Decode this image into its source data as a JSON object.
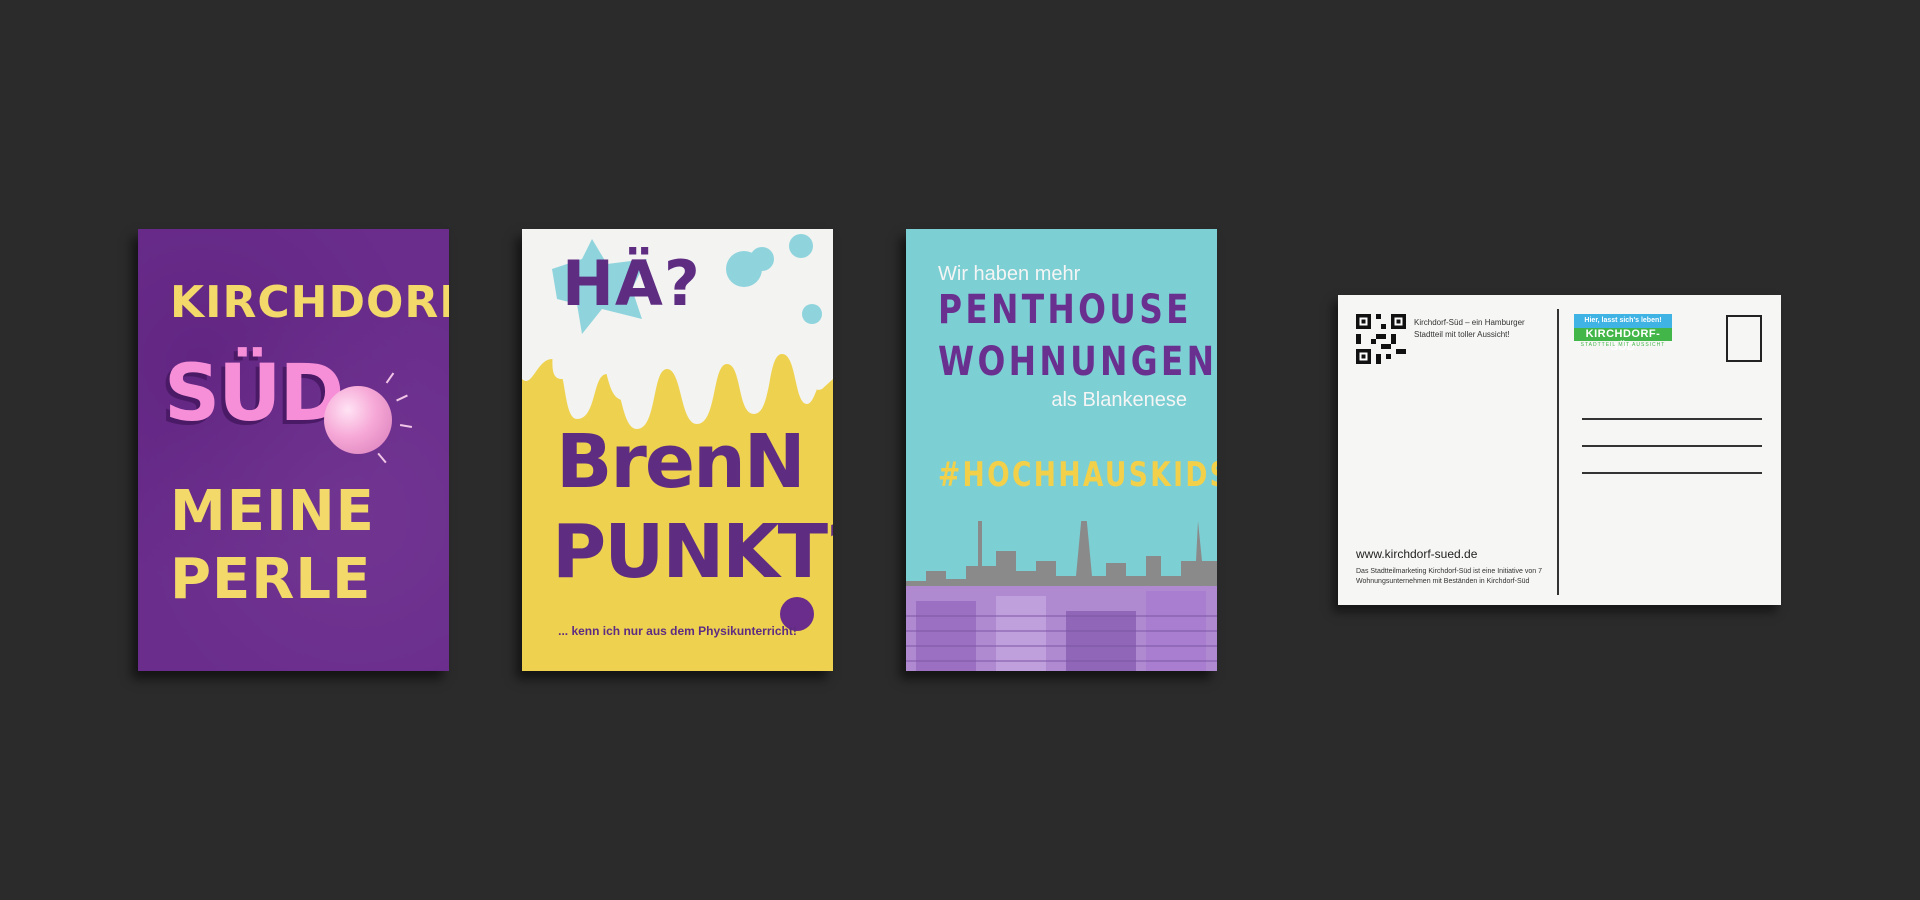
{
  "cards": [
    {
      "lines": [
        "KIRCHDORF",
        "SÜD",
        "MEINE",
        "PERLE"
      ]
    },
    {
      "headline": "HÄ?",
      "line1": "BrenN",
      "line2": "PUNKT?",
      "caption": "... kenn ich nur aus dem Physikunterricht!"
    },
    {
      "intro": "Wir haben mehr",
      "big1": "PENTHOUSE",
      "big2": "WOHNUNGEN",
      "outro": "als Blankenese",
      "hashtag": "#HOCHHAUSKIDS"
    }
  ],
  "postcard": {
    "info_text": "Kirchdorf-Süd – ein Hamburger Stadtteil mit toller Aussicht!",
    "logo_top": "Hier, lasst sich's leben!",
    "logo_main": "KIRCHDORF-SÜD",
    "logo_sub": "STADTTEIL MIT AUSSICHT",
    "url": "www.kirchdorf-sued.de",
    "footer": "Das Stadtteilmarketing Kirchdorf-Süd ist eine Initiative von 7 Wohnungsunternehmen mit Beständen in Kirchdorf-Süd"
  },
  "colors": {
    "background": "#2b2b2b",
    "purple": "#6a2d8c",
    "yellow": "#f3d96a",
    "pink": "#f68fd8",
    "teal": "#7ccfd3"
  }
}
